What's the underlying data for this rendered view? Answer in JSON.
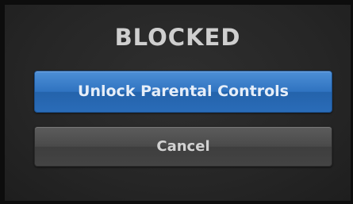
{
  "dialog": {
    "title": "BLOCKED",
    "primary_button_label": "Unlock Parental Controls",
    "secondary_button_label": "Cancel"
  },
  "colors": {
    "primary_button": "#2f73c0",
    "secondary_button": "#4a4a4a",
    "background": "#262626"
  }
}
